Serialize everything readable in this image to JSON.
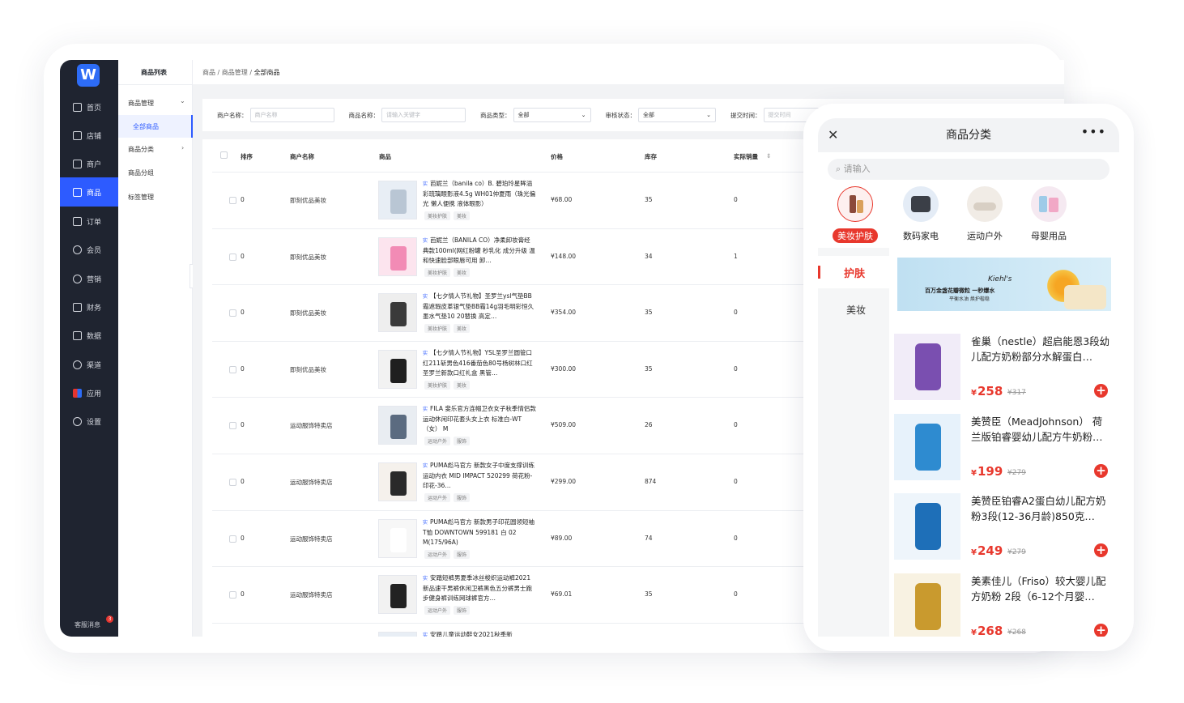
{
  "admin": {
    "logo": "W",
    "nav": [
      {
        "label": "首页",
        "icon": "home-icon"
      },
      {
        "label": "店铺",
        "icon": "store-icon"
      },
      {
        "label": "商户",
        "icon": "merchant-icon"
      },
      {
        "label": "商品",
        "icon": "goods-icon"
      },
      {
        "label": "订单",
        "icon": "order-icon"
      },
      {
        "label": "会员",
        "icon": "member-icon"
      },
      {
        "label": "营销",
        "icon": "marketing-icon"
      },
      {
        "label": "财务",
        "icon": "finance-icon"
      },
      {
        "label": "数据",
        "icon": "data-icon"
      },
      {
        "label": "渠道",
        "icon": "channel-icon"
      },
      {
        "label": "应用",
        "icon": "apps-icon"
      },
      {
        "label": "设置",
        "icon": "settings-icon"
      }
    ],
    "support": "客服消息",
    "support_badge": "3",
    "subnav": {
      "title": "商品列表",
      "items": [
        "商品管理",
        "全部商品",
        "商品分类",
        "商品分组",
        "标签管理"
      ]
    },
    "breadcrumb": [
      "商品",
      "商品管理",
      "全部商品"
    ],
    "filters": [
      {
        "label": "商户名称：",
        "placeholder": "商户名称"
      },
      {
        "label": "商品名称：",
        "placeholder": "请输入关键字"
      },
      {
        "label": "商品类型：",
        "value": "全部"
      },
      {
        "label": "审核状态：",
        "value": "全部"
      },
      {
        "label": "提交时间：",
        "placeholder": "提交时间"
      }
    ],
    "columns": [
      "排序",
      "商户名称",
      "商品",
      "价格",
      "库存",
      "实际销量"
    ],
    "tag_s": "实",
    "rows": [
      {
        "sort": "0",
        "merchant": "即刻优品美妆",
        "name": "芭妮兰（banila co）B. 碧珀玲星眸溢彩琉璃眼影液4.5g WH01仲夏雨（珠光偏光 懒人便携 液体眼影）",
        "tags": [
          "美妆护肤",
          "美妆"
        ],
        "price": "¥68.00",
        "stock": "35",
        "sales": "0"
      },
      {
        "sort": "0",
        "merchant": "即刻优品美妆",
        "name": "芭妮兰（BANILA CO）净柔卸妆膏经典款100ml(网红粉罐 秒乳化 成分升级 温和快速脸部眼唇可用 卸…",
        "tags": [
          "美妆护肤",
          "美妆"
        ],
        "price": "¥148.00",
        "stock": "34",
        "sales": "1"
      },
      {
        "sort": "0",
        "merchant": "即刻优品美妆",
        "name": "【七夕情人节礼物】圣罗兰ysl气垫BB霜遮瑕皮革银气垫BB霜14g羽毛明彩恒久墨水气垫10 20替换 高定…",
        "tags": [
          "美妆护肤",
          "美妆"
        ],
        "price": "¥354.00",
        "stock": "35",
        "sales": "0"
      },
      {
        "sort": "0",
        "merchant": "即刻优品美妆",
        "name": "【七夕情人节礼物】YSL圣罗兰圆管口红211斩男色416番茄色80号杨树林口红圣罗兰新款口红礼盒 黑管…",
        "tags": [
          "美妆护肤",
          "美妆"
        ],
        "price": "¥300.00",
        "stock": "35",
        "sales": "0"
      },
      {
        "sort": "0",
        "merchant": "运动服饰特卖店",
        "name": "FILA 斐乐官方连帽卫衣女子秋季情侣款运动休闲印花套头女上衣 标准白-WT（女） M",
        "tags": [
          "运动户外",
          "服饰"
        ],
        "price": "¥509.00",
        "stock": "26",
        "sales": "0"
      },
      {
        "sort": "0",
        "merchant": "运动服饰特卖店",
        "name": "PUMA彪马官方 新款女子中度支撑训练运动内衣 MID IMPACT 520299 荷花粉-印花-36…",
        "tags": [
          "运动户外",
          "服饰"
        ],
        "price": "¥299.00",
        "stock": "874",
        "sales": "0"
      },
      {
        "sort": "0",
        "merchant": "运动服饰特卖店",
        "name": "PUMA彪马官方 新款男子印花圆领短袖T恤 DOWNTOWN 599181 白 02 M(175/96A)",
        "tags": [
          "运动户外",
          "服饰"
        ],
        "price": "¥89.00",
        "stock": "74",
        "sales": "0"
      },
      {
        "sort": "0",
        "merchant": "运动服饰特卖店",
        "name": "安踏短裤男夏季冰丝梭织运动裤2021新品速干男裤休闲卫裤黑色五分裤男士跑步健身裤训练网球裤官方…",
        "tags": [
          "运动户外",
          "服饰"
        ],
        "price": "¥69.01",
        "stock": "35",
        "sales": "0"
      },
      {
        "sort": "",
        "merchant": "",
        "name": "安踏儿童运动鞋女2021秋季新",
        "tags": [],
        "price": "",
        "stock": "",
        "sales": ""
      }
    ]
  },
  "mobile": {
    "title": "商品分类",
    "search_placeholder": "请输入",
    "categories": [
      "美妆护肤",
      "数码家电",
      "运动户外",
      "母婴用品"
    ],
    "side": [
      "护肤",
      "美妆"
    ],
    "banner": {
      "brand": "Kiehl's",
      "headline": "百万金盏花瓣微粒 一秒爆水",
      "sub": "平衡水油 焕护楷稳"
    },
    "products": [
      {
        "name": "雀巢（nestle）超启能恩3段幼儿配方奶粉部分水解蛋白…",
        "price": "258",
        "orig": "¥317"
      },
      {
        "name": "美赞臣（MeadJohnson） 荷兰版铂睿婴幼儿配方牛奶粉…",
        "price": "199",
        "orig": "¥279"
      },
      {
        "name": "美赞臣铂睿A2蛋白幼儿配方奶粉3段(12-36月龄)850克…",
        "price": "249",
        "orig": "¥279"
      },
      {
        "name": "美素佳儿（Friso）较大婴儿配方奶粉 2段（6-12个月婴…",
        "price": "268",
        "orig": "¥268"
      }
    ],
    "currency": "¥",
    "accent": "#e8382d"
  }
}
